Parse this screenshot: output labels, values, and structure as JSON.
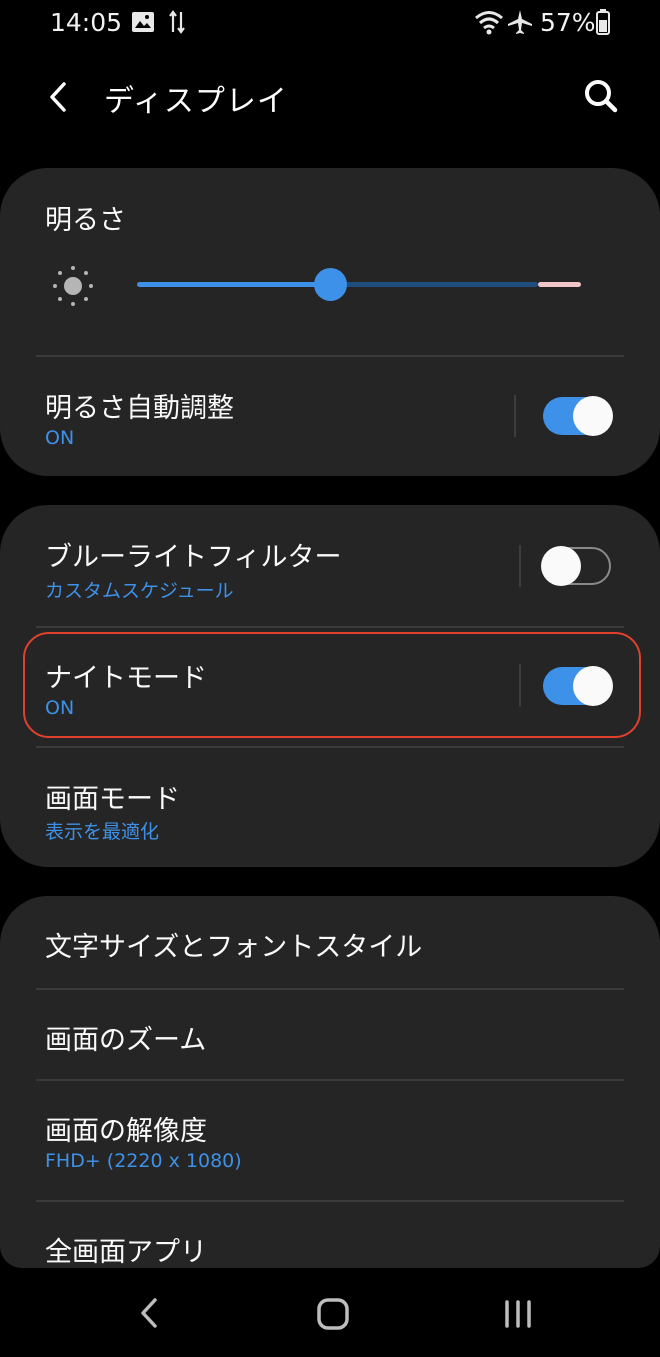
{
  "status_bar": {
    "time": "14:05",
    "battery": "57%",
    "icons": [
      "image-icon",
      "data-transfer-icon",
      "wifi-icon",
      "airplane-icon",
      "battery-icon"
    ]
  },
  "header": {
    "title": "ディスプレイ",
    "back_icon": "chevron-left-icon",
    "search_icon": "search-icon"
  },
  "brightness": {
    "label": "明るさ",
    "level": 0.44
  },
  "auto_brightness": {
    "label": "明るさ自動調整",
    "status": "ON",
    "enabled": true
  },
  "blue_light": {
    "label": "ブルーライトフィルター",
    "status": "カスタムスケジュール",
    "enabled": false
  },
  "night_mode": {
    "label": "ナイトモード",
    "status": "ON",
    "enabled": true
  },
  "screen_mode": {
    "label": "画面モード",
    "status": "表示を最適化"
  },
  "font": {
    "label": "文字サイズとフォントスタイル"
  },
  "zoom": {
    "label": "画面のズーム"
  },
  "resolution": {
    "label": "画面の解像度",
    "status": "FHD+ (2220 x 1080)"
  },
  "fullscreen_apps": {
    "label": "全画面アプリ"
  },
  "colors": {
    "accent": "#3e91e8",
    "card": "#252525",
    "highlight": "#e0402c"
  }
}
